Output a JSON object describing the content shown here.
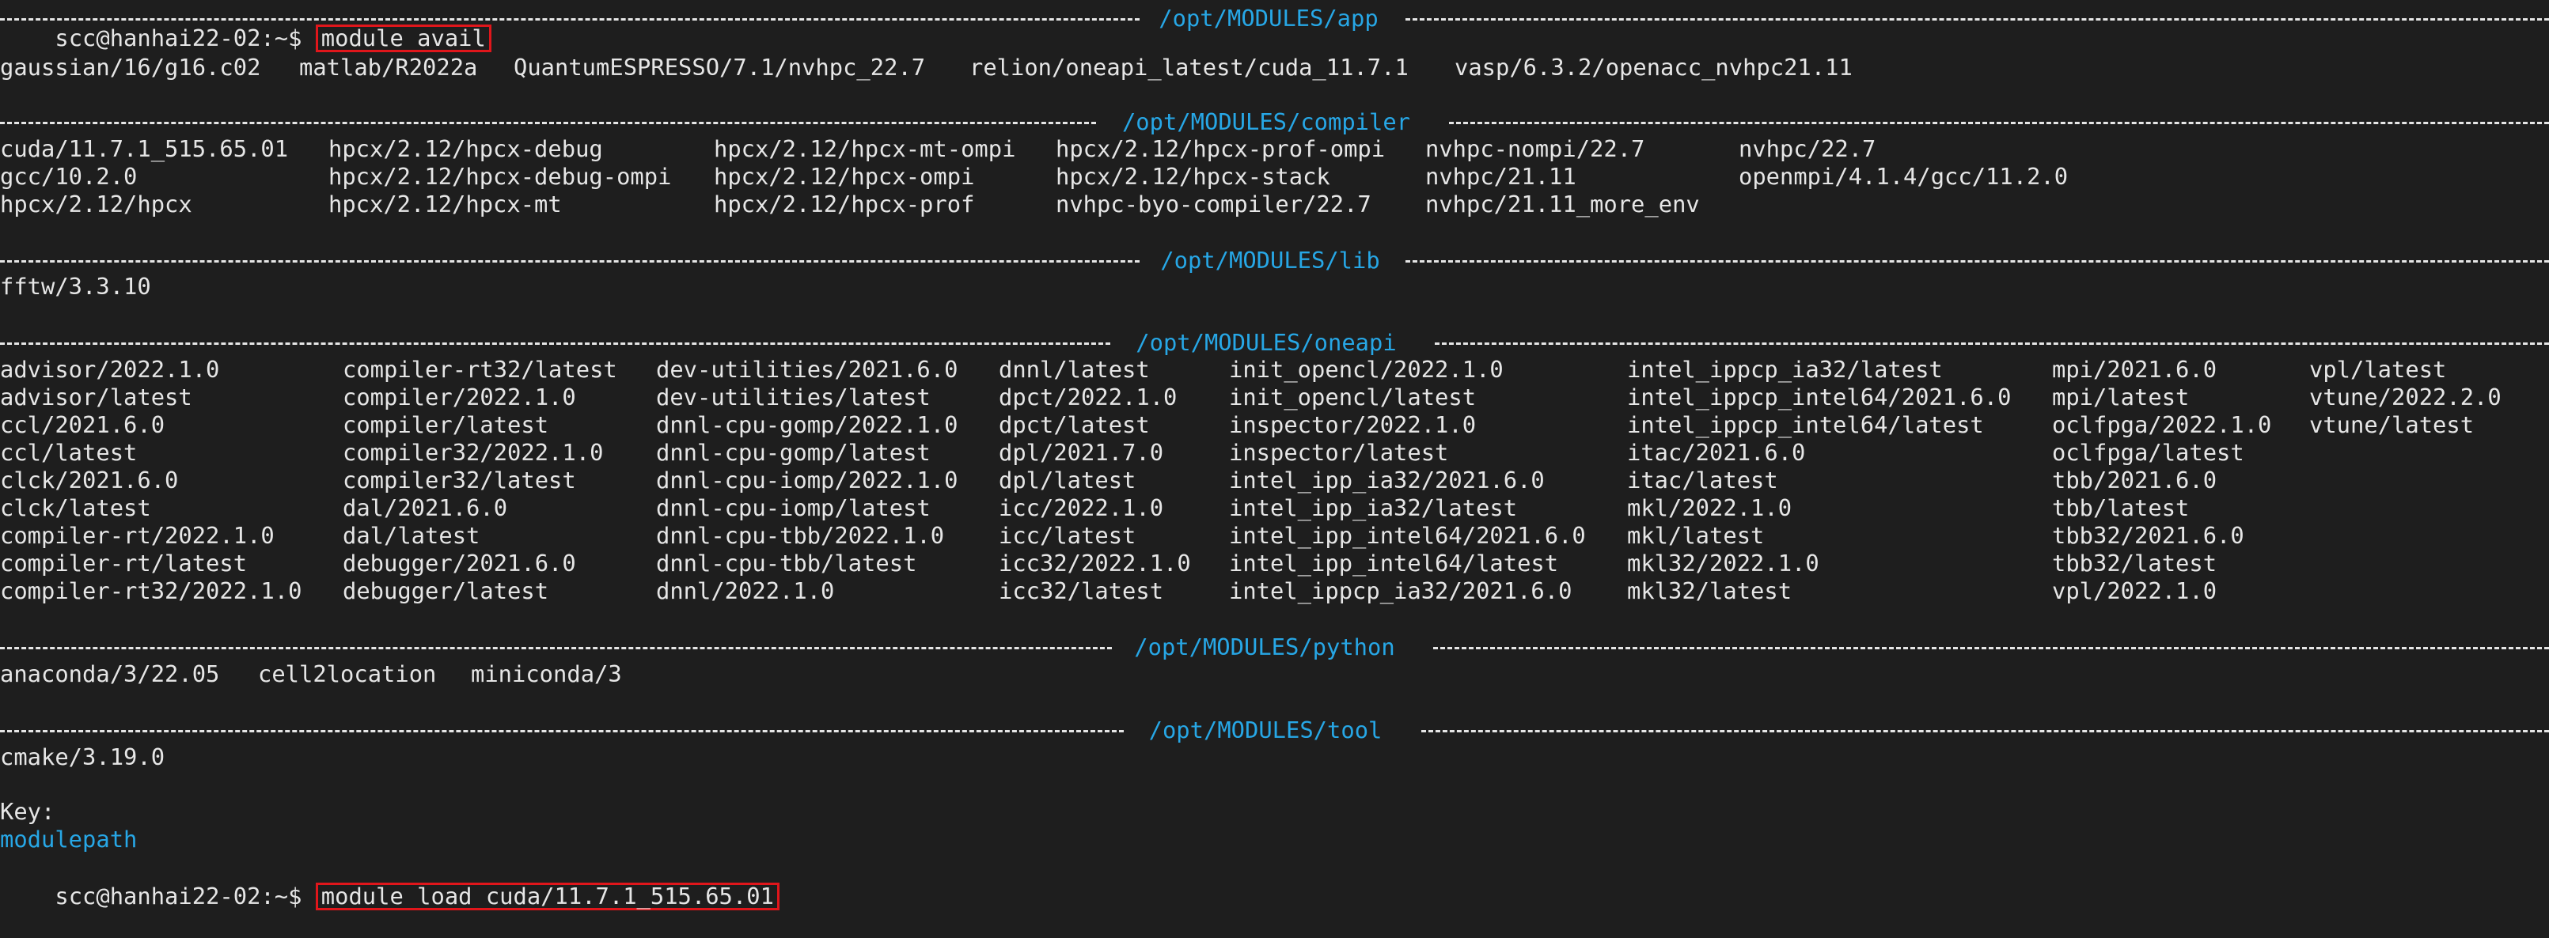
{
  "terminal": {
    "prompt": "scc@hanhai22-02:~$",
    "command_1": "module avail",
    "command_2": "module load cuda/11.7.1_515.65.01"
  },
  "sections": {
    "app": {
      "label": "/opt/MODULES/app",
      "rows": [
        [
          "gaussian/16/g16.c02",
          "matlab/R2022a",
          "QuantumESPRESSO/7.1/nvhpc_22.7",
          "relion/oneapi_latest/cuda_11.7.1",
          "vasp/6.3.2/openacc_nvhpc21.11"
        ]
      ]
    },
    "compiler": {
      "label": "/opt/MODULES/compiler",
      "rows": [
        [
          "cuda/11.7.1_515.65.01",
          "hpcx/2.12/hpcx-debug",
          "hpcx/2.12/hpcx-mt-ompi",
          "hpcx/2.12/hpcx-prof-ompi",
          "nvhpc-nompi/22.7",
          "nvhpc/22.7"
        ],
        [
          "gcc/10.2.0",
          "hpcx/2.12/hpcx-debug-ompi",
          "hpcx/2.12/hpcx-ompi",
          "hpcx/2.12/hpcx-stack",
          "nvhpc/21.11",
          "openmpi/4.1.4/gcc/11.2.0"
        ],
        [
          "hpcx/2.12/hpcx",
          "hpcx/2.12/hpcx-mt",
          "hpcx/2.12/hpcx-prof",
          "nvhpc-byo-compiler/22.7",
          "nvhpc/21.11_more_env",
          ""
        ]
      ]
    },
    "lib": {
      "label": "/opt/MODULES/lib",
      "rows": [
        [
          "fftw/3.3.10"
        ]
      ]
    },
    "oneapi": {
      "label": "/opt/MODULES/oneapi",
      "rows": [
        [
          "advisor/2022.1.0",
          "compiler-rt32/latest",
          "dev-utilities/2021.6.0",
          "dnnl/latest",
          "init_opencl/2022.1.0",
          "intel_ippcp_ia32/latest",
          "mpi/2021.6.0",
          "vpl/latest"
        ],
        [
          "advisor/latest",
          "compiler/2022.1.0",
          "dev-utilities/latest",
          "dpct/2022.1.0",
          "init_opencl/latest",
          "intel_ippcp_intel64/2021.6.0",
          "mpi/latest",
          "vtune/2022.2.0"
        ],
        [
          "ccl/2021.6.0",
          "compiler/latest",
          "dnnl-cpu-gomp/2022.1.0",
          "dpct/latest",
          "inspector/2022.1.0",
          "intel_ippcp_intel64/latest",
          "oclfpga/2022.1.0",
          "vtune/latest"
        ],
        [
          "ccl/latest",
          "compiler32/2022.1.0",
          "dnnl-cpu-gomp/latest",
          "dpl/2021.7.0",
          "inspector/latest",
          "itac/2021.6.0",
          "oclfpga/latest",
          ""
        ],
        [
          "clck/2021.6.0",
          "compiler32/latest",
          "dnnl-cpu-iomp/2022.1.0",
          "dpl/latest",
          "intel_ipp_ia32/2021.6.0",
          "itac/latest",
          "tbb/2021.6.0",
          ""
        ],
        [
          "clck/latest",
          "dal/2021.6.0",
          "dnnl-cpu-iomp/latest",
          "icc/2022.1.0",
          "intel_ipp_ia32/latest",
          "mkl/2022.1.0",
          "tbb/latest",
          ""
        ],
        [
          "compiler-rt/2022.1.0",
          "dal/latest",
          "dnnl-cpu-tbb/2022.1.0",
          "icc/latest",
          "intel_ipp_intel64/2021.6.0",
          "mkl/latest",
          "tbb32/2021.6.0",
          ""
        ],
        [
          "compiler-rt/latest",
          "debugger/2021.6.0",
          "dnnl-cpu-tbb/latest",
          "icc32/2022.1.0",
          "intel_ipp_intel64/latest",
          "mkl32/2022.1.0",
          "tbb32/latest",
          ""
        ],
        [
          "compiler-rt32/2022.1.0",
          "debugger/latest",
          "dnnl/2022.1.0",
          "icc32/latest",
          "intel_ippcp_ia32/2021.6.0",
          "mkl32/latest",
          "vpl/2022.1.0",
          ""
        ]
      ]
    },
    "python": {
      "label": "/opt/MODULES/python",
      "rows": [
        [
          "anaconda/3/22.05",
          "cell2location",
          "miniconda/3"
        ]
      ]
    },
    "tool": {
      "label": "/opt/MODULES/tool",
      "rows": [
        [
          "cmake/3.19.0"
        ]
      ]
    }
  },
  "key": {
    "title": "Key:",
    "entry": "modulepath"
  },
  "colors": {
    "background": "#1e1e1e",
    "text": "#e6e6e6",
    "path_label": "#27a7e6",
    "highlight_box": "#e0161b"
  }
}
